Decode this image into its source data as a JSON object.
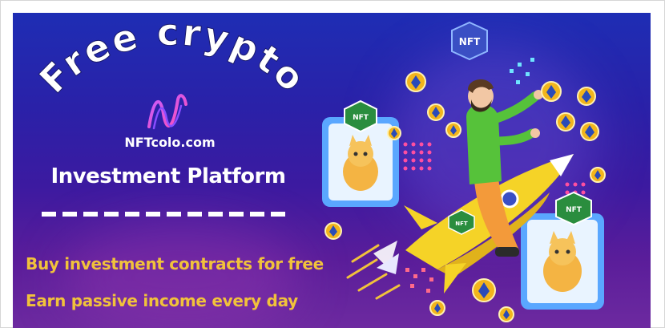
{
  "banner": {
    "headline": "Free crypto",
    "site": "NFTcolo.com",
    "platform": "Investment Platform",
    "taglines": [
      "Buy investment contracts for free",
      "Earn passive income every day"
    ]
  },
  "badges": {
    "top": "NFT",
    "left_card": "NFT",
    "right_card": "NFT",
    "rocket": "NFT"
  },
  "colors": {
    "tagline": "#f1c23b",
    "coin": "#f2b51c",
    "badge_green": "#2a8d3e",
    "badge_blue": "#3a4fc4",
    "card_blue": "#5aa7ff",
    "card_bg": "#e9f4ff"
  }
}
